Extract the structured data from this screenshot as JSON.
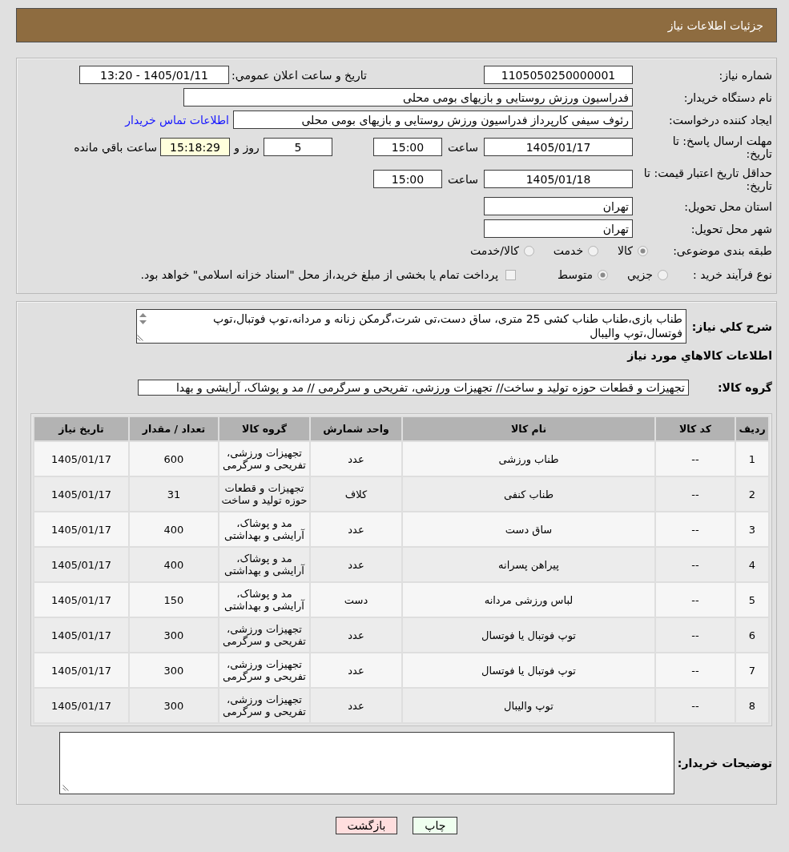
{
  "header": {
    "title": "جزئیات اطلاعات نیاز"
  },
  "need_info": {
    "need_number": {
      "label": "شماره نیاز:",
      "value": "1105050250000001"
    },
    "announcement": {
      "label": "تاریخ و ساعت اعلان عمومي:",
      "value": "1405/01/11 - 13:20"
    },
    "buyer_org": {
      "label": "نام دستگاه خريدار:",
      "value": "فدراسیون ورزش روستایی و بازیهای بومی محلی"
    },
    "requester": {
      "label": "ایجاد کننده درخواست:",
      "value": "رئوف سیفی کارپرداز فدراسیون ورزش روستایی و بازیهای بومی محلی",
      "contact_link": "اطلاعات تماس خريدار"
    },
    "response_deadline": {
      "label": "مهلت ارسال پاسخ: تا تاریخ:",
      "date": "1405/01/17",
      "time_label": "ساعت",
      "time": "15:00",
      "days": "5",
      "days_label": "روز و",
      "remaining": "15:18:29",
      "remaining_label": "ساعت باقي مانده"
    },
    "price_validity": {
      "label": "حداقل تاریخ اعتبار قیمت: تا تاریخ:",
      "date": "1405/01/18",
      "time_label": "ساعت",
      "time": "15:00"
    },
    "delivery_province": {
      "label": "استان محل تحویل:",
      "value": "تهران"
    },
    "delivery_city": {
      "label": "شهر محل تحویل:",
      "value": "تهران"
    },
    "subject_class": {
      "label": "طبقه بندی موضوعی:",
      "options": [
        {
          "label": "کالا",
          "selected": true
        },
        {
          "label": "خدمت",
          "selected": false
        },
        {
          "label": "کالا/خدمت",
          "selected": false
        }
      ]
    },
    "purchase_process": {
      "label": "نوع فرآیند خرید :",
      "options": [
        {
          "label": "جزيي",
          "selected": false
        },
        {
          "label": "متوسط",
          "selected": true
        }
      ],
      "treasury_payment": {
        "label": "پرداخت تمام یا بخشی از مبلغ خرید،از محل \"اسناد خزانه اسلامی\" خواهد بود.",
        "checked": false
      }
    }
  },
  "requirements": {
    "description": {
      "label": "شرح کلي نياز:",
      "value": "طناب بازی،طناب طناب کشی 25 متری، ساق دست،تی شرت،گرمکن زنانه و مردانه،توپ فوتبال،توپ فوتسال،توپ والیبال"
    },
    "goods_heading": "اطلاعات کالاهاي مورد نياز",
    "goods_group": {
      "label": "گروه کالا:",
      "value": "تجهیزات و قطعات حوزه تولید و ساخت// تجهیزات ورزشی، تفریحی و سرگرمی // مد و پوشاک، آرایشی و بهدا"
    },
    "table": {
      "columns": [
        "ردیف",
        "کد کالا",
        "نام کالا",
        "واحد شمارش",
        "گروه کالا",
        "تعداد / مقدار",
        "تاریخ نیاز"
      ],
      "rows": [
        [
          "1",
          "--",
          "طناب ورزشی",
          "عدد",
          "تجهیزات ورزشی، تفریحی و سرگرمی",
          "600",
          "1405/01/17"
        ],
        [
          "2",
          "--",
          "طناب کنفی",
          "کلاف",
          "تجهیزات و قطعات حوزه تولید و ساخت",
          "31",
          "1405/01/17"
        ],
        [
          "3",
          "--",
          "ساق دست",
          "عدد",
          "مد و پوشاک، آرایشی و بهداشتی",
          "400",
          "1405/01/17"
        ],
        [
          "4",
          "--",
          "پیراهن پسرانه",
          "عدد",
          "مد و پوشاک، آرایشی و بهداشتی",
          "400",
          "1405/01/17"
        ],
        [
          "5",
          "--",
          "لباس ورزشی مردانه",
          "دست",
          "مد و پوشاک، آرایشی و بهداشتی",
          "150",
          "1405/01/17"
        ],
        [
          "6",
          "--",
          "توپ فوتبال یا فوتسال",
          "عدد",
          "تجهیزات ورزشی، تفریحی و سرگرمی",
          "300",
          "1405/01/17"
        ],
        [
          "7",
          "--",
          "توپ فوتبال یا فوتسال",
          "عدد",
          "تجهیزات ورزشی، تفریحی و سرگرمی",
          "300",
          "1405/01/17"
        ],
        [
          "8",
          "--",
          "توپ والیبال",
          "عدد",
          "تجهیزات ورزشی، تفریحی و سرگرمی",
          "300",
          "1405/01/17"
        ]
      ]
    },
    "buyer_notes": {
      "label": "توضیحات خریدار:"
    }
  },
  "buttons": [
    {
      "label": "چاپ",
      "kind": "print"
    },
    {
      "label": "بازگشت",
      "kind": "back"
    }
  ]
}
